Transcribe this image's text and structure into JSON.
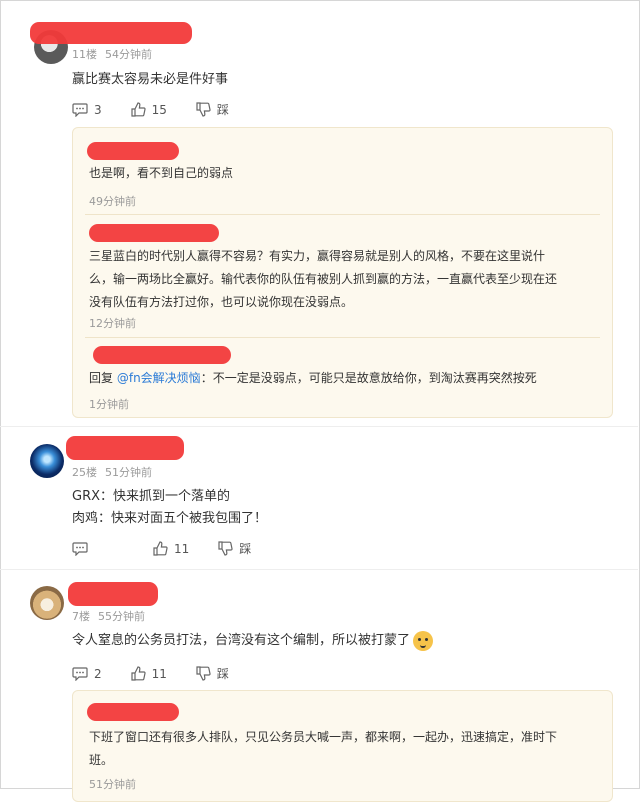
{
  "c1": {
    "floor": "11楼",
    "time": "54分钟前",
    "content": "赢比赛太容易未必是件好事",
    "actions": {
      "comments": "3",
      "likes": "15",
      "dislike": "踩"
    },
    "replies": [
      {
        "text": "也是啊，看不到自己的弱点",
        "time": "49分钟前"
      },
      {
        "lines": [
          "三星蓝白的时代别人赢得不容易？有实力，赢得容易就是别人的风格，不要在这里说什",
          "么，输一两场比全赢好。输代表你的队伍有被别人抓到赢的方法，一直赢代表至少现在还",
          "没有队伍有方法打过你，也可以说你现在没弱点。"
        ],
        "time": "12分钟前"
      },
      {
        "prefix": "回复",
        "mention": "@fn会解决烦恼",
        "sep": "：",
        "text": "不一定是没弱点，可能只是故意放给你，到淘汰赛再突然按死",
        "time": "1分钟前"
      }
    ]
  },
  "c2": {
    "floor": "25楼",
    "time": "51分钟前",
    "lines": [
      "GRX：快来抓到一个落单的",
      "肉鸡：快来对面五个被我包围了！"
    ],
    "actions": {
      "likes": "11",
      "dislike": "踩"
    }
  },
  "c3": {
    "floor": "7楼",
    "time": "55分钟前",
    "content": "令人窒息的公务员打法，台湾没有这个编制，所以被打蒙了",
    "actions": {
      "comments": "2",
      "likes": "11",
      "dislike": "踩"
    },
    "replies": [
      {
        "lines": [
          "下班了窗口还有很多人排队，只见公务员大喊一声，都来啊，一起办，迅速搞定，准时下",
          "班。"
        ],
        "time": "51分钟前"
      }
    ]
  },
  "colors": {
    "redaction": "#f23a3a",
    "reply_bg": "#fdf9ee",
    "mention": "#2b7bd6"
  }
}
